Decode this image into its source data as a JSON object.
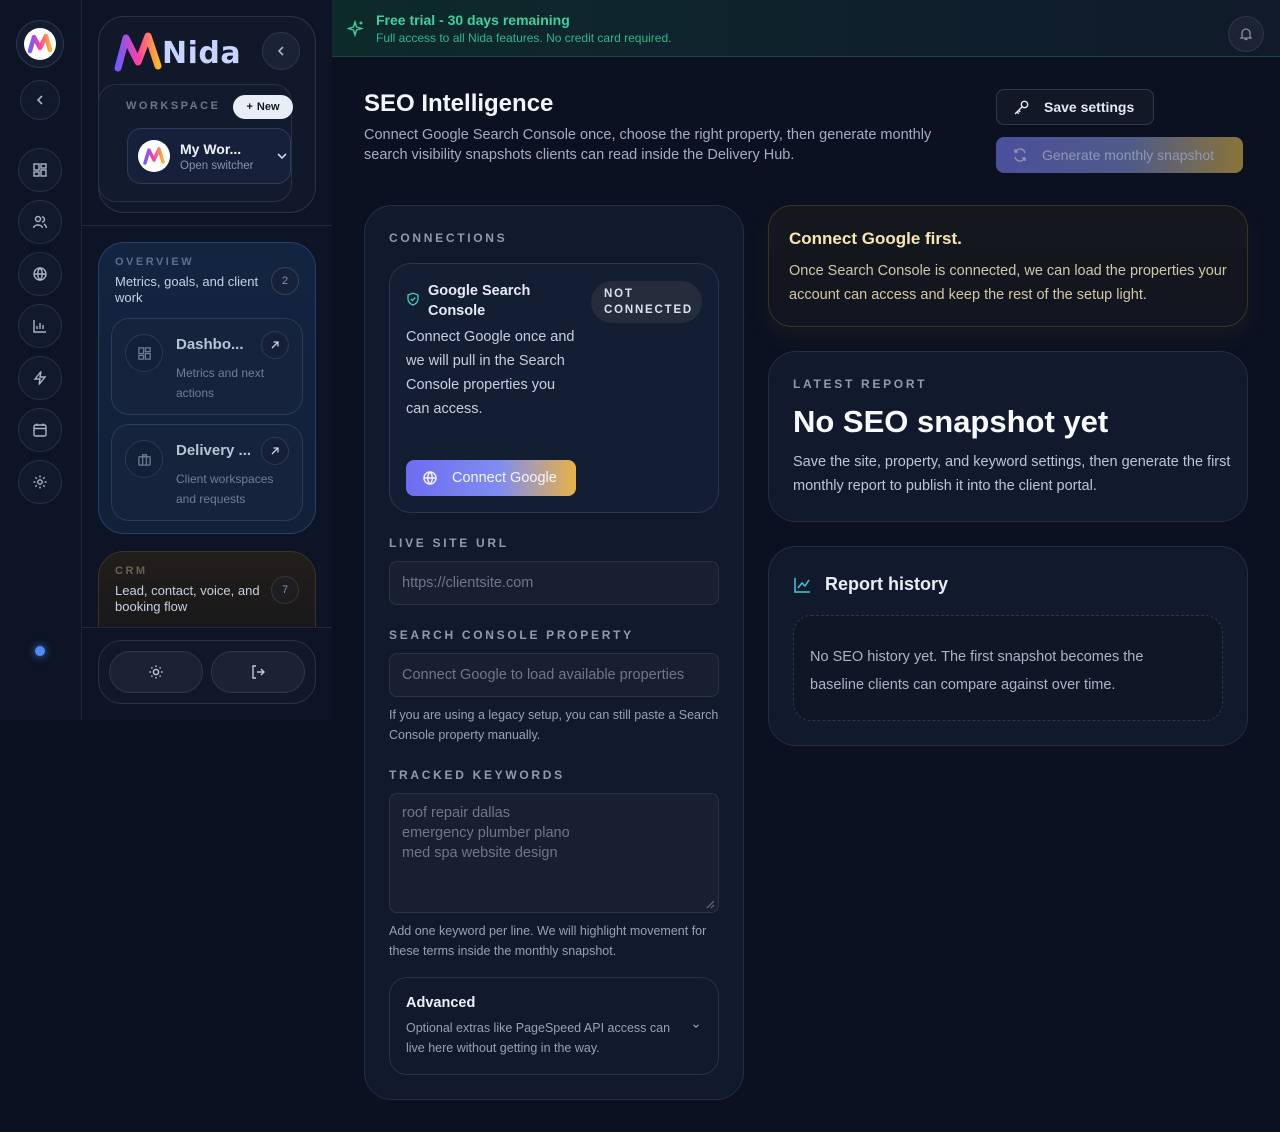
{
  "banner": {
    "title": "Free trial - 30 days remaining",
    "subtitle": "Full access to all Nida features. No credit card required."
  },
  "sidebar": {
    "brand": "Nida",
    "workspace_label": "WORKSPACE",
    "new_label": "New",
    "workspace_name": "My Wor...",
    "workspace_hint": "Open switcher",
    "overview": {
      "label": "OVERVIEW",
      "description": "Metrics, goals, and client work",
      "count": "2",
      "items": [
        {
          "title": "Dashbo...",
          "subtitle": "Metrics and next actions"
        },
        {
          "title": "Delivery ...",
          "subtitle": "Client workspaces and requests"
        }
      ]
    },
    "crm": {
      "label": "CRM",
      "description": "Lead, contact, voice, and booking flow",
      "count": "7"
    }
  },
  "rail": {
    "icons": [
      "grid-icon",
      "users-icon",
      "globe-icon",
      "bar-chart-icon",
      "bolt-icon",
      "calendar-icon",
      "settings-icon"
    ]
  },
  "page": {
    "title": "SEO Intelligence",
    "subtitle": "Connect Google Search Console once, choose the right property, then generate monthly search visibility snapshots clients can read inside the Delivery Hub.",
    "save_label": "Save settings",
    "generate_label": "Generate monthly snapshot"
  },
  "connections": {
    "label": "CONNECTIONS",
    "gsc_title": "Google Search Console",
    "gsc_status": "NOT CONNECTED",
    "gsc_desc": "Connect Google once and we will pull in the Search Console properties you can access.",
    "connect_label": "Connect Google",
    "site_url_label": "LIVE SITE URL",
    "site_url_placeholder": "https://clientsite.com",
    "property_label": "SEARCH CONSOLE PROPERTY",
    "property_placeholder": "Connect Google to load available properties",
    "property_help": "If you are using a legacy setup, you can still paste a Search Console property manually.",
    "keywords_label": "TRACKED KEYWORDS",
    "keywords_placeholder": "roof repair dallas\nemergency plumber plano\nmed spa website design",
    "keywords_help": "Add one keyword per line. We will highlight movement for these terms inside the monthly snapshot.",
    "advanced_title": "Advanced",
    "advanced_desc": "Optional extras like PageSpeed API access can live here without getting in the way."
  },
  "notice": {
    "title": "Connect Google first.",
    "body": "Once Search Console is connected, we can load the properties your account can access and keep the rest of the setup light."
  },
  "latest": {
    "label": "LATEST REPORT",
    "title": "No SEO snapshot yet",
    "body": "Save the site, property, and keyword settings, then generate the first monthly report to publish it into the client portal."
  },
  "history": {
    "title": "Report history",
    "empty": "No SEO history yet. The first snapshot becomes the baseline clients can compare against over time."
  },
  "colors": {
    "accent_green": "#41d0a0",
    "warn_gold": "#f7e6b3",
    "brand_indigo": "#6e6cf0",
    "background": "#0b1121"
  }
}
